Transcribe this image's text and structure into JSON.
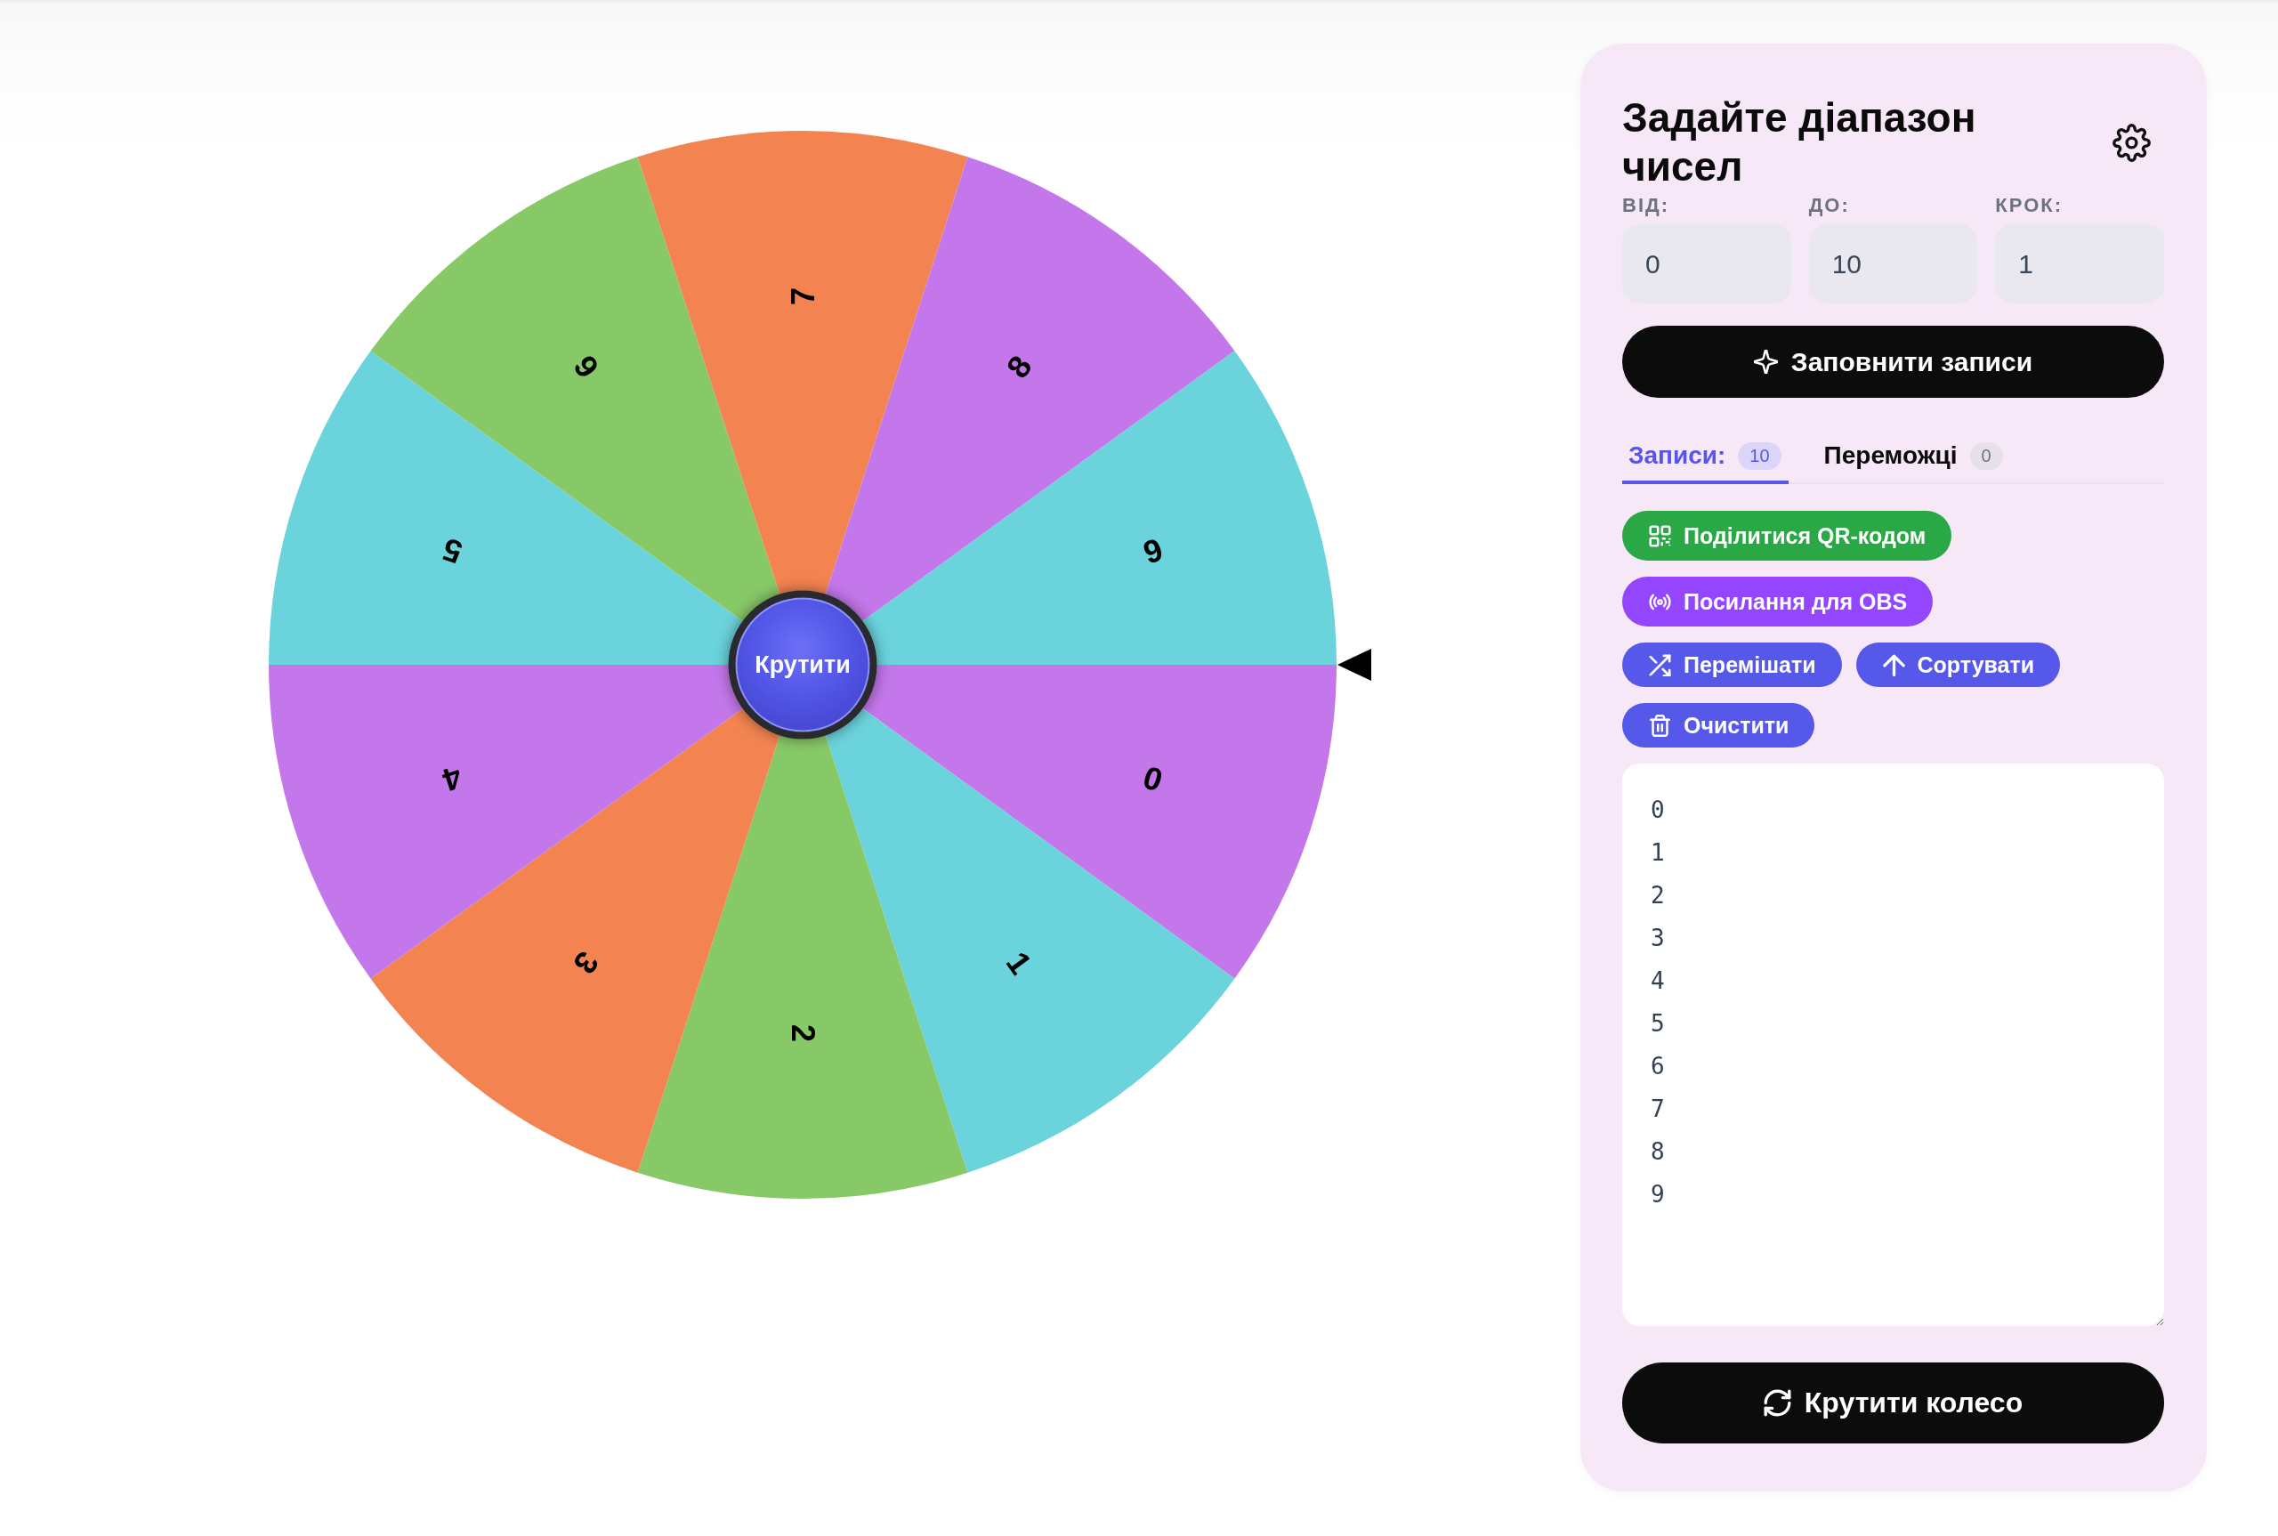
{
  "wheel": {
    "segments": [
      {
        "label": "0",
        "color": "#c477eb"
      },
      {
        "label": "1",
        "color": "#6bd3dc"
      },
      {
        "label": "2",
        "color": "#88c967"
      },
      {
        "label": "3",
        "color": "#f38452"
      },
      {
        "label": "4",
        "color": "#c477eb"
      },
      {
        "label": "5",
        "color": "#6bd3dc"
      },
      {
        "label": "6",
        "color": "#88c967"
      },
      {
        "label": "7",
        "color": "#f38452"
      },
      {
        "label": "8",
        "color": "#c477eb"
      },
      {
        "label": "9",
        "color": "#6bd3dc"
      }
    ],
    "center_button": "Крутити"
  },
  "panel": {
    "title": "Задайте діапазон чисел",
    "range_fields": [
      {
        "label": "ВІД:",
        "value": "0"
      },
      {
        "label": "ДО:",
        "value": "10"
      },
      {
        "label": "КРОК:",
        "value": "1"
      }
    ],
    "fill_button": "Заповнити записи",
    "tabs": [
      {
        "label": "Записи:",
        "count": "10",
        "selected": true
      },
      {
        "label": "Переможці",
        "count": "0",
        "selected": false
      }
    ],
    "action_rows": [
      [
        {
          "kind": "qr",
          "label": "Поділитися QR-кодом"
        }
      ],
      [
        {
          "kind": "obs",
          "label": "Посилання для OBS"
        }
      ],
      [
        {
          "kind": "shuffle",
          "label": "Перемішати"
        },
        {
          "kind": "sort",
          "label": "Сортувати"
        }
      ],
      [
        {
          "kind": "clear",
          "label": "Очистити"
        }
      ]
    ],
    "entries": [
      "0",
      "1",
      "2",
      "3",
      "4",
      "5",
      "6",
      "7",
      "8",
      "9"
    ],
    "spin_button": "Крутити колесо"
  }
}
